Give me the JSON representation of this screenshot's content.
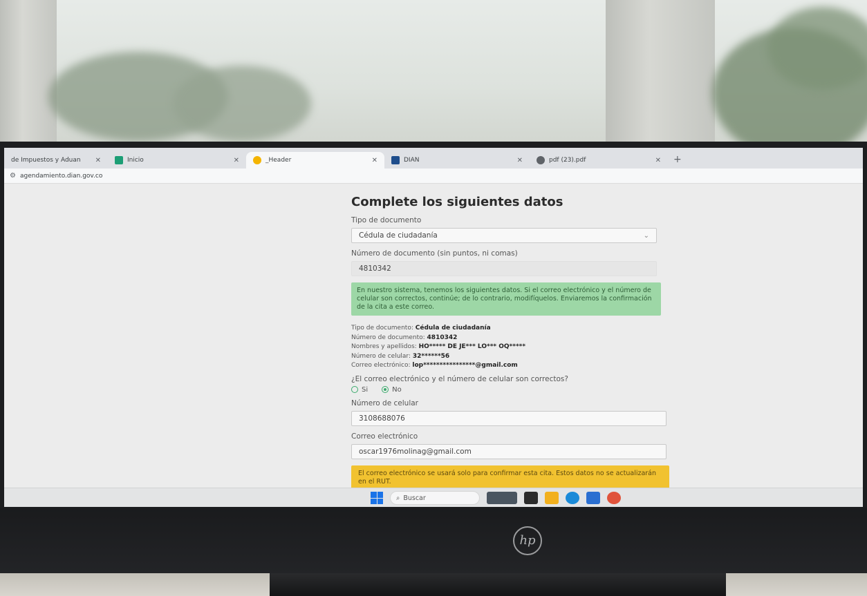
{
  "browser": {
    "tabs": [
      {
        "label": "de Impuestos y Aduan",
        "active": false,
        "favicon_color": "#4a7ab8"
      },
      {
        "label": "Inicio",
        "active": false,
        "favicon_color": "#1c9e75"
      },
      {
        "label": "_Header",
        "active": true,
        "favicon_color": "#f4b400"
      },
      {
        "label": "DIAN",
        "active": false,
        "favicon_color": "#1f4e8c"
      },
      {
        "label": "pdf (23).pdf",
        "active": false,
        "favicon_color": "#5f6368"
      }
    ],
    "new_tab": "+",
    "close_glyph": "✕",
    "url": "agendamiento.dian.gov.co"
  },
  "form": {
    "title": "Complete los siguientes datos",
    "doc_type_label": "Tipo de documento",
    "doc_type_value": "Cédula de ciudadanía",
    "doc_number_label": "Número de documento (sin puntos, ni comas)",
    "doc_number_value": "4810342",
    "info_alert": "En nuestro sistema, tenemos los siguientes datos. Si el correo electrónico y el número de celular son correctos, continúe; de lo contrario, modifíquelos. Enviaremos la confirmación de la cita a este correo.",
    "details": [
      {
        "key": "Tipo de documento:",
        "value": "Cédula de ciudadanía"
      },
      {
        "key": "Número de documento:",
        "value": "4810342"
      },
      {
        "key": "Nombres y apellidos:",
        "value": "HO***** DE JE*** LO*** OQ*****"
      },
      {
        "key": "Número de celular:",
        "value": "32******56"
      },
      {
        "key": "Correo electrónico:",
        "value": "lop****************@gmail.com"
      }
    ],
    "question": "¿El correo electrónico y el número de celular son correctos?",
    "option_yes": "Si",
    "option_no": "No",
    "selected_option": "No",
    "cell_label": "Número de celular",
    "cell_value": "3108688076",
    "email_label": "Correo electrónico",
    "email_value": "oscar1976molinag@gmail.com",
    "warning_alert": "El correo electrónico se usará solo para confirmar esta cita. Estos datos no se actualizarán en el RUT."
  },
  "taskbar": {
    "search_placeholder": "Buscar",
    "apps": [
      {
        "name": "landscape-app-icon",
        "color": "#4a5560"
      },
      {
        "name": "task-view-icon",
        "color": "#2b2b2b"
      },
      {
        "name": "file-explorer-icon",
        "color": "#f2b01e"
      },
      {
        "name": "edge-icon",
        "color": "#1a8ad8"
      },
      {
        "name": "store-icon",
        "color": "#2a6fd1"
      },
      {
        "name": "chrome-icon",
        "color": "#e0533b"
      }
    ]
  },
  "monitor": {
    "brand": "hp"
  }
}
